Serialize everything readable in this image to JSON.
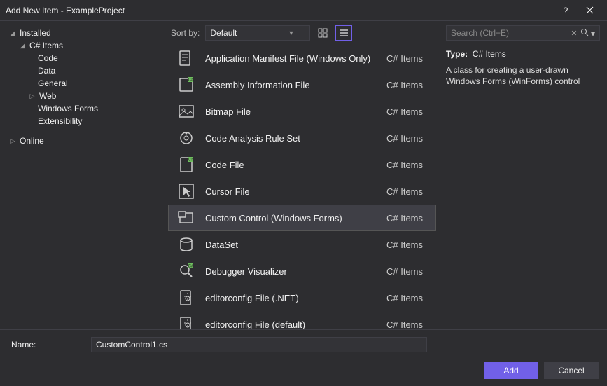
{
  "window": {
    "title": "Add New Item - ExampleProject"
  },
  "tree": {
    "installed": "Installed",
    "csitems": "C# Items",
    "code": "Code",
    "data": "Data",
    "general": "General",
    "web": "Web",
    "winforms": "Windows Forms",
    "extensibility": "Extensibility",
    "online": "Online"
  },
  "sort": {
    "label": "Sort by:",
    "value": "Default"
  },
  "search": {
    "placeholder": "Search (Ctrl+E)"
  },
  "items": [
    {
      "label": "Application Manifest File (Windows Only)",
      "cat": "C# Items"
    },
    {
      "label": "Assembly Information File",
      "cat": "C# Items"
    },
    {
      "label": "Bitmap File",
      "cat": "C# Items"
    },
    {
      "label": "Code Analysis Rule Set",
      "cat": "C# Items"
    },
    {
      "label": "Code File",
      "cat": "C# Items"
    },
    {
      "label": "Cursor File",
      "cat": "C# Items"
    },
    {
      "label": "Custom Control (Windows Forms)",
      "cat": "C# Items"
    },
    {
      "label": "DataSet",
      "cat": "C# Items"
    },
    {
      "label": "Debugger Visualizer",
      "cat": "C# Items"
    },
    {
      "label": "editorconfig File (.NET)",
      "cat": "C# Items"
    },
    {
      "label": "editorconfig File (default)",
      "cat": "C# Items"
    }
  ],
  "details": {
    "type_label": "Type:",
    "type_value": "C# Items",
    "description": "A class for creating a user-drawn Windows Forms (WinForms) control"
  },
  "footer": {
    "name_label": "Name:",
    "name_value": "CustomControl1.cs",
    "add": "Add",
    "cancel": "Cancel"
  }
}
